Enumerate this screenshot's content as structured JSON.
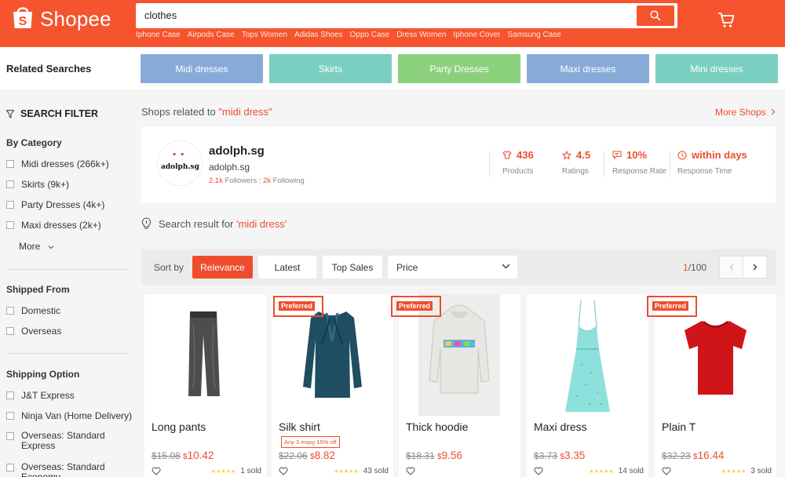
{
  "colors": {
    "brand": "#f6542e",
    "accent": "#ee4d2d"
  },
  "header": {
    "logo_text": "Shopee",
    "search_value": "clothes",
    "suggestions": [
      "Iphone Case",
      "Airpods Case",
      "Tops Women",
      "Adidas Shoes",
      "Oppo Case",
      "Dress Women",
      "Iphone Cover",
      "Samsung Case"
    ]
  },
  "related": {
    "title": "Related Searches",
    "items": [
      {
        "label": "Midi dresses",
        "color": "#88aad8"
      },
      {
        "label": "Skirts",
        "color": "#7acfc0"
      },
      {
        "label": "Party Dresses",
        "color": "#8bd17c"
      },
      {
        "label": "Maxi dresses",
        "color": "#88aad8"
      },
      {
        "label": "Mini dresses",
        "color": "#7acfc0"
      }
    ]
  },
  "sidebar": {
    "title": "SEARCH FILTER",
    "category": {
      "title": "By Category",
      "items": [
        "Midi dresses (266k+)",
        "Skirts (9k+)",
        "Party Dresses (4k+)",
        "Maxi dresses (2k+)"
      ],
      "more": "More"
    },
    "shipped_from": {
      "title": "Shipped From",
      "items": [
        "Domestic",
        "Overseas"
      ]
    },
    "shipping_option": {
      "title": "Shipping Option",
      "items": [
        "J&T Express",
        "Ninja Van (Home Delivery)",
        "Overseas: Standard Express",
        "Overseas: Standard Economy"
      ]
    }
  },
  "shops": {
    "heading_prefix": "Shops related to ",
    "keyword": "\"midi dress\"",
    "more": "More Shops",
    "shop": {
      "avatar_text": "adolph.sg",
      "name": "adolph.sg",
      "username": "adolph.sg",
      "followers": "2.1k",
      "followers_label": "Followers",
      "following": "2k",
      "following_label": "Following",
      "stats": [
        {
          "icon": "shirt-icon",
          "value": "436",
          "label": "Products"
        },
        {
          "icon": "star-icon",
          "value": "4.5",
          "label": "Ratings"
        },
        {
          "icon": "chat-icon",
          "value": "10%",
          "label": "Response Rate"
        },
        {
          "icon": "clock-icon",
          "value": "within days",
          "label": "Response Time"
        }
      ]
    }
  },
  "result": {
    "prefix": "Search result for ",
    "keyword": "'midi dress'"
  },
  "sortbar": {
    "label": "Sort by",
    "options": [
      "Relevance",
      "Latest",
      "Top Sales"
    ],
    "active": "Relevance",
    "price_label": "Price",
    "page_current": "1",
    "page_total": "/100"
  },
  "products": [
    {
      "name": "Long pants",
      "preferred": false,
      "promo": "",
      "old_price": "$15.08",
      "currency": "$",
      "price": "10.42",
      "sold": "1 sold",
      "rating": 5,
      "icon": "pants-icon"
    },
    {
      "name": "Silk shirt",
      "preferred": true,
      "promo": "Any 3 enjoy 15% off",
      "old_price": "$22.06",
      "currency": "$",
      "price": "8.82",
      "sold": "43 sold",
      "rating": 5,
      "icon": "shirt-icon"
    },
    {
      "name": "Thick hoodie",
      "preferred": true,
      "promo": "",
      "old_price": "$18.31",
      "currency": "$",
      "price": "9.56",
      "sold": "",
      "rating": 0,
      "icon": "hoodie-icon"
    },
    {
      "name": "Maxi dress",
      "preferred": false,
      "promo": "",
      "old_price": "$3.73",
      "currency": "$",
      "price": "3.35",
      "sold": "14 sold",
      "rating": 5,
      "icon": "dress-icon"
    },
    {
      "name": "Plain T",
      "preferred": true,
      "promo": "",
      "old_price": "$32.23",
      "currency": "$",
      "price": "16.44",
      "sold": "3 sold",
      "rating": 5,
      "icon": "tshirt-icon"
    }
  ],
  "preferred_label": "Preferred"
}
